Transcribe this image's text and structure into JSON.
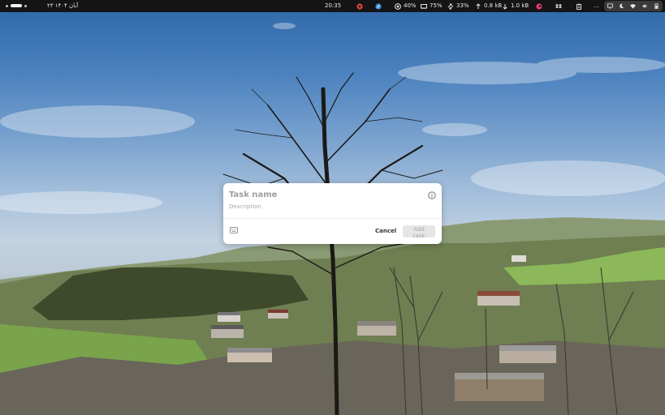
{
  "topbar": {
    "date": "۲۳ آبان ۱۴۰۴",
    "clock": "20:35",
    "indicators": [
      {
        "icon": "cpu-icon",
        "value": "40%"
      },
      {
        "icon": "memory-icon",
        "value": "75%"
      },
      {
        "icon": "swap-icon",
        "value": "33%"
      },
      {
        "icon": "upload-icon",
        "value": "0.8 kB"
      },
      {
        "icon": "download-icon",
        "value": "1.0 kB"
      }
    ],
    "overflow": "..."
  },
  "dialog": {
    "task_name_placeholder": "Task name",
    "description_placeholder": "Description",
    "cancel_label": "Cancel",
    "add_label": "Add task"
  },
  "colors": {
    "panel_bg": "#141414",
    "dialog_bg": "#ffffff",
    "add_button_disabled_bg": "#e6e6e6",
    "add_button_disabled_text": "#a6a6a6"
  }
}
